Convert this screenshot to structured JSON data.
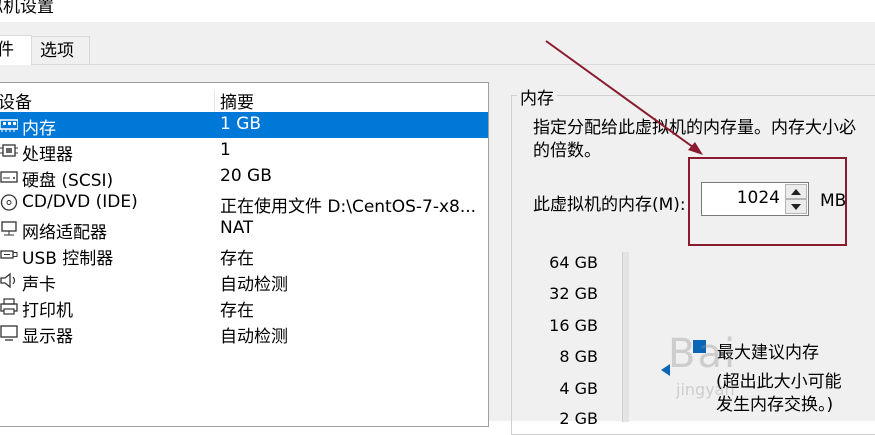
{
  "window": {
    "title": "拟机设置"
  },
  "tabs": [
    {
      "label": "件",
      "active": true
    },
    {
      "label": "选项",
      "active": false
    }
  ],
  "device_list": {
    "columns": [
      "设备",
      "摘要"
    ],
    "rows": [
      {
        "icon": "memory-icon",
        "name": "内存",
        "summary": "1 GB",
        "selected": true
      },
      {
        "icon": "processor-icon",
        "name": "处理器",
        "summary": "1"
      },
      {
        "icon": "harddisk-icon",
        "name": "硬盘 (SCSI)",
        "summary": "20 GB"
      },
      {
        "icon": "cd-dvd-icon",
        "name": "CD/DVD (IDE)",
        "summary": "正在使用文件 D:\\CentOS-7-x8..."
      },
      {
        "icon": "network-adapter-icon",
        "name": "网络适配器",
        "summary": "NAT"
      },
      {
        "icon": "usb-icon",
        "name": "USB 控制器",
        "summary": "存在"
      },
      {
        "icon": "sound-icon",
        "name": "声卡",
        "summary": "自动检测"
      },
      {
        "icon": "printer-icon",
        "name": "打印机",
        "summary": "存在"
      },
      {
        "icon": "display-icon",
        "name": "显示器",
        "summary": "自动检测"
      }
    ]
  },
  "memory": {
    "group_title": "内存",
    "description_line1": "指定分配给此虚拟机的内存量。内存大小必",
    "description_line2": "的倍数。",
    "field_label": "此虚拟机的内存(M):",
    "value": "1024",
    "unit": "MB",
    "scale_labels": [
      "64 GB",
      "32 GB",
      "16 GB",
      "8 GB",
      "4 GB",
      "2 GB"
    ],
    "recommended_title": "最大建议内存",
    "recommended_note_line1": "(超出此大小可能",
    "recommended_note_line2": "发生内存交换。)"
  },
  "watermark": {
    "text": "Bai",
    "sub": "jingyan"
  },
  "colors": {
    "selection": "#0078d7",
    "annotation": "#8b1a2e",
    "marker": "#0b66b8"
  }
}
